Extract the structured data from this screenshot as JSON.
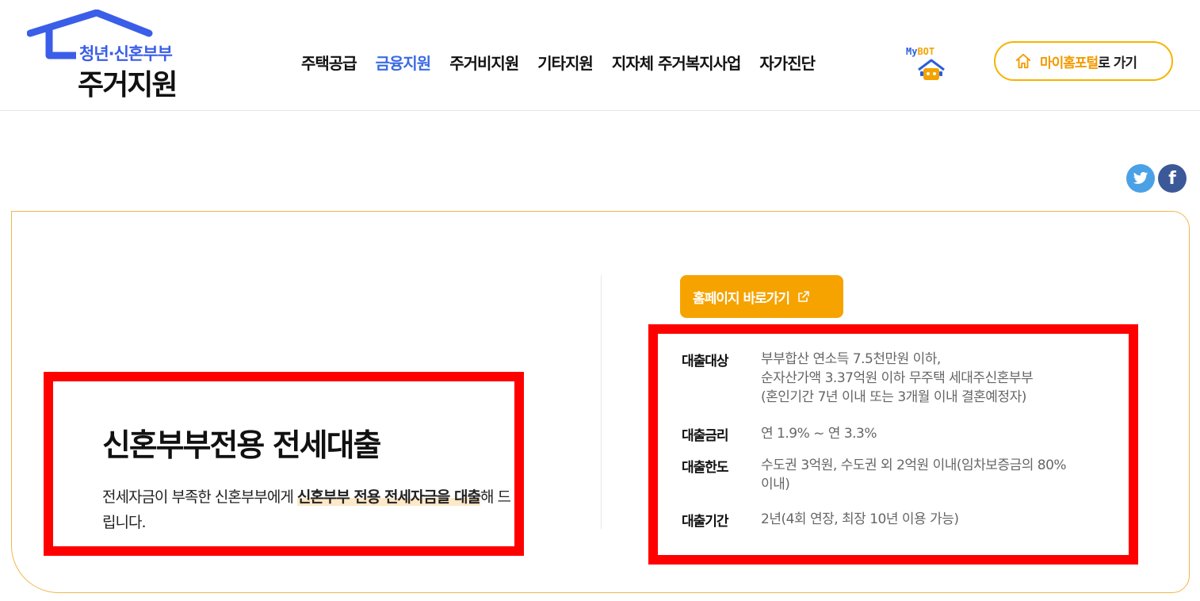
{
  "logo": {
    "sub": "청년·신혼부부",
    "main": "주거지원"
  },
  "nav": {
    "items": [
      {
        "label": "주택공급",
        "active": false
      },
      {
        "label": "금융지원",
        "active": true
      },
      {
        "label": "주거비지원",
        "active": false
      },
      {
        "label": "기타지원",
        "active": false
      },
      {
        "label": "지자체 주거복지사업",
        "active": false
      },
      {
        "label": "자가진단",
        "active": false
      }
    ]
  },
  "mybot": {
    "my": "My",
    "bot": "BOT"
  },
  "portal": {
    "highlight": "마이홈포털",
    "rest": "로 가기"
  },
  "share": {
    "facebook": "f"
  },
  "product": {
    "title": "신혼부부전용 전세대출",
    "desc_prefix": "전세자금이 부족한 신혼부부에게 ",
    "desc_highlight": "신혼부부 전용 전세자금을 대출",
    "desc_suffix": "해 드립니다."
  },
  "homepage_button": "홈페이지 바로가기",
  "info": [
    {
      "label": "대출대상",
      "lines": [
        "부부합산 연소득 7.5천만원 이하,",
        "순자산가액 3.37억원 이하 무주택 세대주신혼부부",
        "(혼인기간 7년 이내 또는 3개월 이내 결혼예정자)"
      ]
    },
    {
      "label": "대출금리",
      "lines": [
        "연 1.9% ~ 연 3.3%"
      ]
    },
    {
      "label": "대출한도",
      "lines": [
        "수도권 3억원, 수도권 외 2억원 이내(임차보증금의 80%",
        "이내)"
      ]
    },
    {
      "label": "대출기간",
      "lines": [
        "2년(4회 연장, 최장 10년 이용 가능)"
      ]
    }
  ],
  "colors": {
    "accent": "#f6a300",
    "brand_blue": "#3a6ae6",
    "highlight_box": "#ff0000"
  }
}
